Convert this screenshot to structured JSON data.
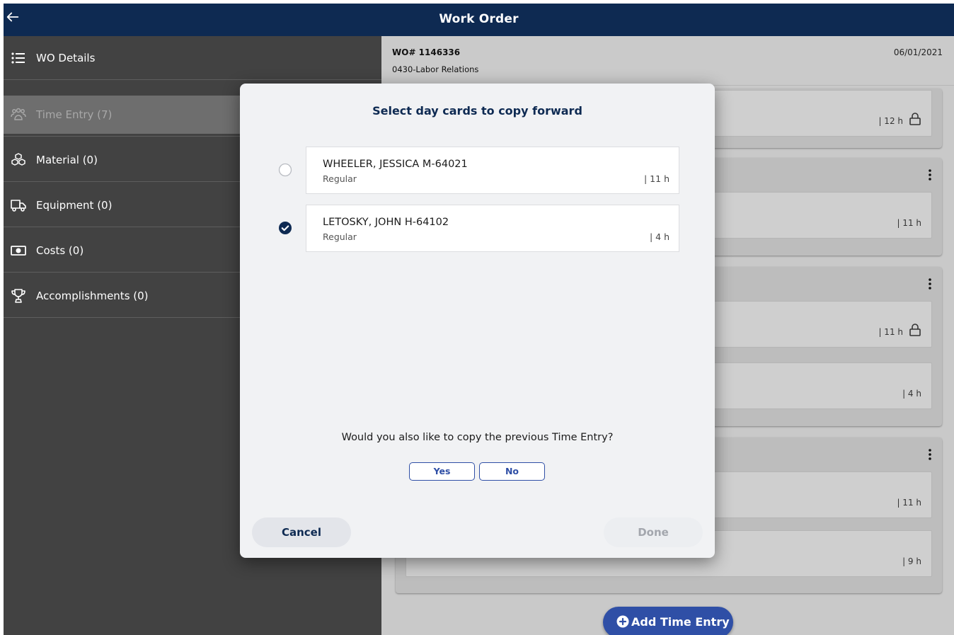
{
  "header": {
    "title": "Work Order",
    "back_icon": "arrow-left-icon"
  },
  "sidebar": {
    "items": [
      {
        "label": "WO Details",
        "icon": "list-icon",
        "active": false
      },
      {
        "label": "Time Entry (7)",
        "icon": "people-icon",
        "active": true
      },
      {
        "label": "Material (0)",
        "icon": "boxes-icon",
        "active": false
      },
      {
        "label": "Equipment (0)",
        "icon": "truck-icon",
        "active": false
      },
      {
        "label": "Costs (0)",
        "icon": "cash-icon",
        "active": false
      },
      {
        "label": "Accomplishments (0)",
        "icon": "trophy-icon",
        "active": false
      }
    ]
  },
  "work_order": {
    "number": "WO# 1146336",
    "department": "0430-Labor Relations",
    "date": "06/01/2021"
  },
  "background_cards": [
    {
      "hours": "| 12 h",
      "locked": true
    },
    {
      "hours": "| 11 h",
      "locked": false
    },
    {
      "hours": "| 11 h",
      "locked": true
    },
    {
      "hours": "| 4 h",
      "locked": false
    },
    {
      "hours": "| 11 h",
      "locked": false
    },
    {
      "hours": "| 9 h",
      "locked": false
    }
  ],
  "add_button": {
    "label": "Add Time Entry"
  },
  "modal": {
    "title": "Select day cards to copy forward",
    "entries": [
      {
        "name": "WHEELER, JESSICA M-64021",
        "type": "Regular",
        "hours": "| 11 h",
        "selected": false
      },
      {
        "name": "LETOSKY, JOHN H-64102",
        "type": "Regular",
        "hours": "| 4 h",
        "selected": true
      }
    ],
    "question": "Would you also like to copy the previous Time Entry?",
    "yes_label": "Yes",
    "no_label": "No",
    "cancel_label": "Cancel",
    "done_label": "Done"
  },
  "colors": {
    "header_bg": "#0e2a52",
    "sidebar_bg": "#424242",
    "accent": "#2f4fa6"
  }
}
